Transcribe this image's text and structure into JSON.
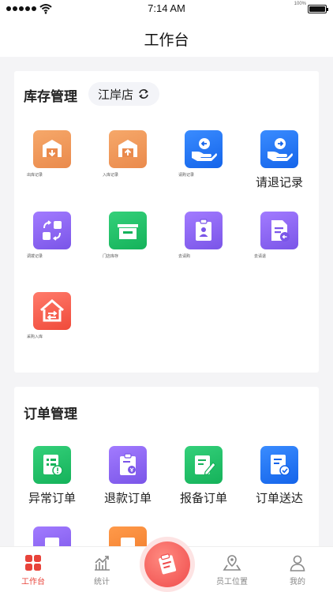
{
  "status_bar": {
    "time": "7:14 AM",
    "battery_percent": "100%"
  },
  "nav": {
    "title": "工作台"
  },
  "inventory": {
    "title": "库存管理",
    "store": "江岸店",
    "items": [
      {
        "label": "出库记录",
        "icon": "warehouse-out-icon"
      },
      {
        "label": "入库记录",
        "icon": "warehouse-in-icon"
      },
      {
        "label": "请购记录",
        "icon": "purchase-request-icon"
      },
      {
        "label": "请退记录",
        "icon": "return-request-icon"
      },
      {
        "label": "调拨记录",
        "icon": "transfer-icon"
      },
      {
        "label": "门店库存",
        "icon": "store-stock-icon"
      },
      {
        "label": "去请购",
        "icon": "clipboard-user-icon"
      },
      {
        "label": "去请退",
        "icon": "document-return-icon"
      },
      {
        "label": "采购入库",
        "icon": "purchase-in-icon"
      }
    ]
  },
  "orders": {
    "title": "订单管理",
    "items": [
      {
        "label": "异常订单",
        "icon": "abnormal-order-icon"
      },
      {
        "label": "退款订单",
        "icon": "refund-order-icon"
      },
      {
        "label": "报备订单",
        "icon": "report-order-icon"
      },
      {
        "label": "订单送达",
        "icon": "order-delivered-icon"
      }
    ]
  },
  "tabbar": {
    "items": [
      {
        "label": "工作台",
        "active": true
      },
      {
        "label": "统计",
        "active": false
      },
      {
        "label": "",
        "active": false
      },
      {
        "label": "员工位置",
        "active": false
      },
      {
        "label": "我的",
        "active": false
      }
    ]
  },
  "colors": {
    "accent": "#e8433a",
    "orange": "#ea8a4c",
    "blue": "#1464ea",
    "purple": "#7a55e8",
    "green": "#15b25a",
    "red": "#f04a3a"
  }
}
